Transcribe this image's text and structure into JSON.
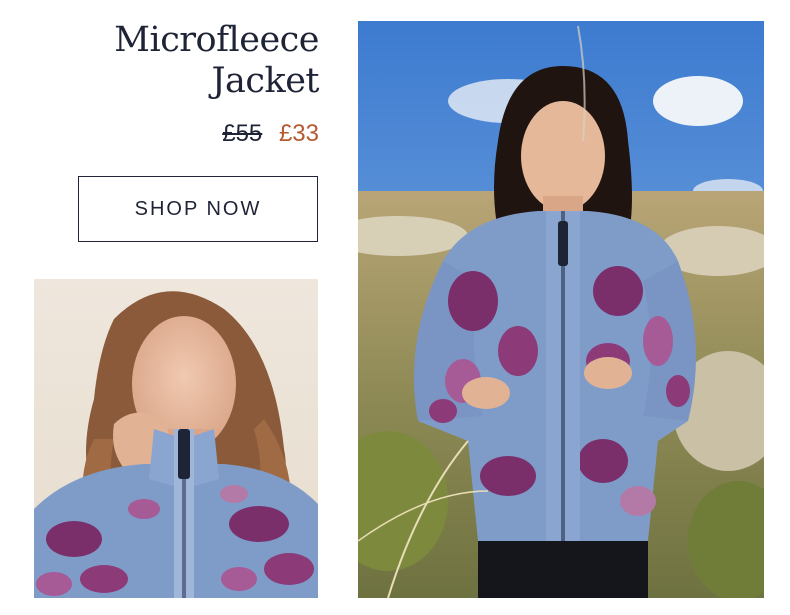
{
  "product": {
    "title_line1": "Microfleece",
    "title_line2": "Jacket",
    "price_old": "£55",
    "price_new": "£33"
  },
  "cta": {
    "label": "SHOP NOW"
  },
  "colors": {
    "text_navy": "#1e2336",
    "sale_price": "#b55a32",
    "jacket_blue": "#7f9cc9",
    "jacket_purple": "#7a2f6b"
  }
}
